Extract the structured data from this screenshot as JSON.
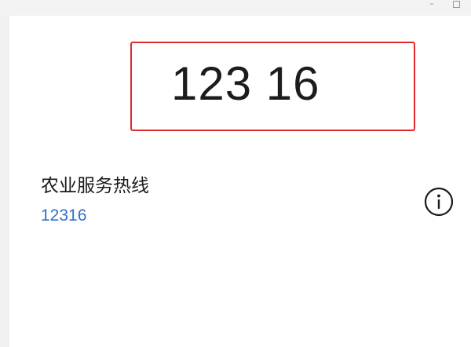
{
  "window": {
    "minimize_glyph": "–",
    "icons": [
      "minimize-icon",
      "maximize-icon"
    ]
  },
  "dialer": {
    "display_number": "123 16"
  },
  "contact": {
    "name": "农业服务热线",
    "number": "12316",
    "number_color": "#2f6fc7",
    "info_icon": "info-circle-icon"
  },
  "colors": {
    "highlight_border": "#e0292a",
    "panel_background": "#ffffff",
    "window_background": "#f0f0f0"
  }
}
